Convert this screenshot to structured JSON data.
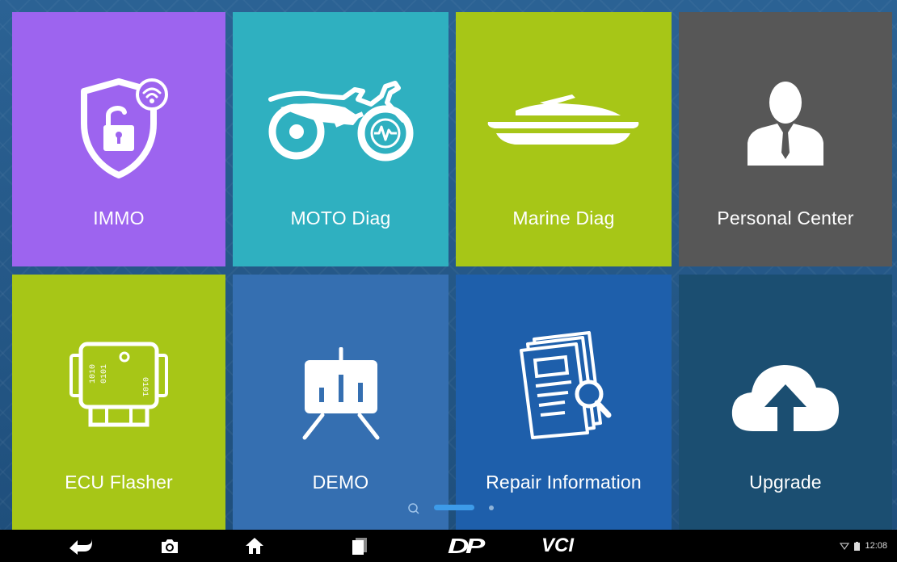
{
  "tiles": [
    {
      "label": "IMMO",
      "icon": "immo-shield-lock-icon",
      "color": "#9d64ef"
    },
    {
      "label": "MOTO Diag",
      "icon": "motorcycle-icon",
      "color": "#2fb0c0"
    },
    {
      "label": "Marine Diag",
      "icon": "jet-ski-icon",
      "color": "#a7c617"
    },
    {
      "label": "Personal Center",
      "icon": "person-icon",
      "color": "#575757"
    },
    {
      "label": "ECU Flasher",
      "icon": "ecu-chip-icon",
      "color": "#a7c617"
    },
    {
      "label": "DEMO",
      "icon": "presentation-board-icon",
      "color": "#356fb1"
    },
    {
      "label": "Repair Information",
      "icon": "document-search-icon",
      "color": "#1e5fab"
    },
    {
      "label": "Upgrade",
      "icon": "cloud-upload-icon",
      "color": "#1b4e71"
    }
  ],
  "page_indicator": {
    "current_page": 1,
    "total_pages": 2
  },
  "navbar": {
    "buttons": [
      "back-icon",
      "camera-icon",
      "home-icon",
      "recent-apps-icon",
      "dp-logo-icon",
      "vci-logo-icon"
    ],
    "vci_text": "VCI",
    "dp_text": "DP"
  },
  "status": {
    "time": "12:08",
    "wifi_icon": "wifi-icon",
    "battery_icon": "battery-icon"
  }
}
